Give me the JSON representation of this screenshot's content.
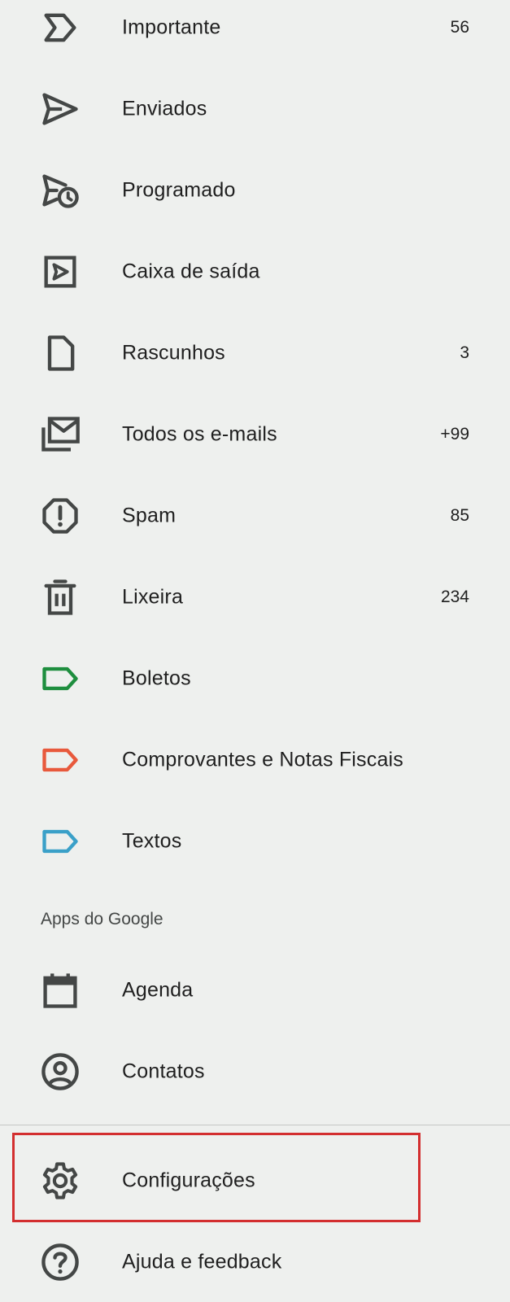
{
  "menu": {
    "items": [
      {
        "label": "Importante",
        "count": "56"
      },
      {
        "label": "Enviados",
        "count": ""
      },
      {
        "label": "Programado",
        "count": ""
      },
      {
        "label": "Caixa de saída",
        "count": ""
      },
      {
        "label": "Rascunhos",
        "count": "3"
      },
      {
        "label": "Todos os e-mails",
        "count": "+99"
      },
      {
        "label": "Spam",
        "count": "85"
      },
      {
        "label": "Lixeira",
        "count": "234"
      },
      {
        "label": "Boletos",
        "count": ""
      },
      {
        "label": "Comprovantes e Notas Fiscais",
        "count": ""
      },
      {
        "label": "Textos",
        "count": ""
      }
    ]
  },
  "label_colors": {
    "boletos": "#1e8e3e",
    "comprovantes": "#e8593c",
    "textos": "#3aa0c8"
  },
  "apps_section": {
    "header": "Apps do Google",
    "items": [
      {
        "label": "Agenda"
      },
      {
        "label": "Contatos"
      }
    ]
  },
  "footer": {
    "items": [
      {
        "label": "Configurações"
      },
      {
        "label": "Ajuda e feedback"
      }
    ]
  },
  "highlight_color": "#d32f2f"
}
